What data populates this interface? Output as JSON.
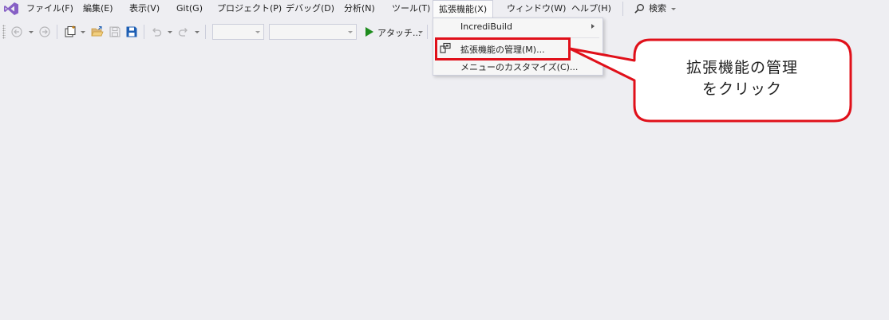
{
  "menubar": {
    "items": [
      {
        "label": "ファイル(F)"
      },
      {
        "label": "編集(E)"
      },
      {
        "label": "表示(V)"
      },
      {
        "label": "Git(G)"
      },
      {
        "label": "プロジェクト(P)"
      },
      {
        "label": "デバッグ(D)"
      },
      {
        "label": "分析(N)"
      },
      {
        "label": "ツール(T)"
      },
      {
        "label": "拡張機能(X)",
        "active": true
      },
      {
        "label": "ウィンドウ(W)"
      },
      {
        "label": "ヘルプ(H)"
      }
    ],
    "search_label": "検索",
    "search_icon": "search-icon"
  },
  "toolbar": {
    "attach_label": "アタッチ..."
  },
  "dropdown": {
    "items": [
      {
        "label": "IncrediBuild",
        "has_submenu": true
      },
      {
        "label": "拡張機能の管理(M)...",
        "icon": "manage-extensions-icon",
        "highlighted": true
      },
      {
        "label": "メニューのカスタマイズ(C)..."
      }
    ]
  },
  "callout": {
    "line1": "拡張機能の管理",
    "line2": "をクリック"
  },
  "colors": {
    "background": "#eeeef2",
    "vs_purple": "#865fc5",
    "highlight_red": "#e0101a",
    "play_green": "#1e8c1e",
    "save_blue": "#1e5fb4"
  }
}
